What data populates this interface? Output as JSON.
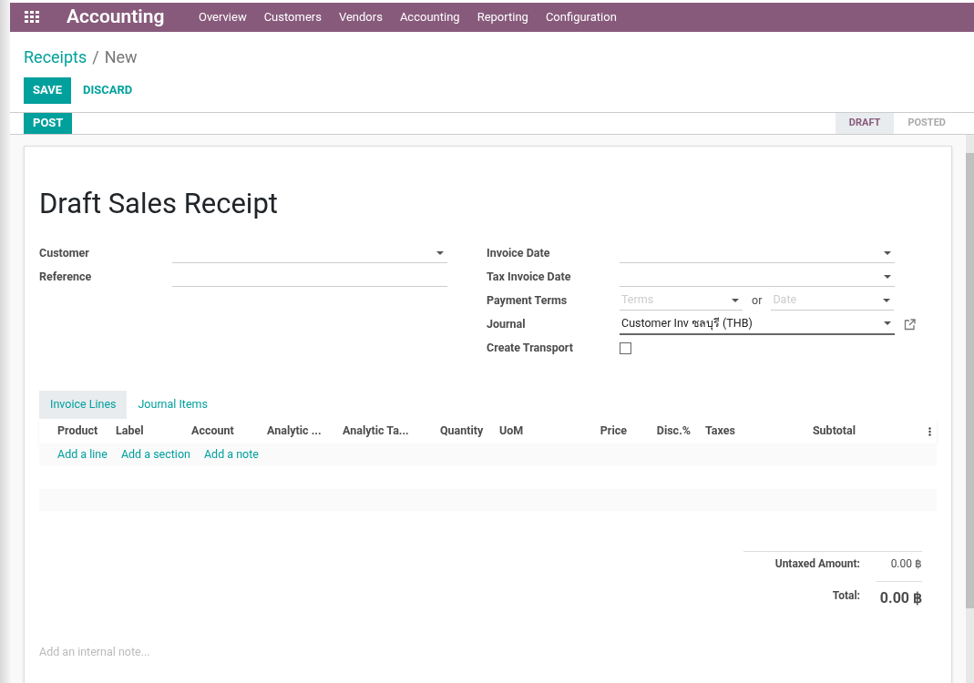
{
  "navbar": {
    "app_title": "Accounting",
    "menu": [
      "Overview",
      "Customers",
      "Vendors",
      "Accounting",
      "Reporting",
      "Configuration"
    ]
  },
  "breadcrumb": {
    "parent": "Receipts",
    "separator": "/",
    "current": "New"
  },
  "buttons": {
    "save": "SAVE",
    "discard": "DISCARD",
    "post": "POST"
  },
  "stages": [
    {
      "label": "DRAFT",
      "selected": true
    },
    {
      "label": "POSTED",
      "selected": false
    }
  ],
  "form": {
    "title": "Draft Sales Receipt",
    "left_fields": [
      {
        "label": "Customer",
        "kind": "dropdown"
      },
      {
        "label": "Reference",
        "kind": "text"
      }
    ],
    "right_fields": [
      {
        "label": "Invoice Date",
        "kind": "dropdown"
      },
      {
        "label": "Tax Invoice Date",
        "kind": "dropdown"
      },
      {
        "label": "Payment Terms",
        "kind": "terms",
        "placeholder": "Terms",
        "or": "or",
        "placeholder_2": "Date"
      },
      {
        "label": "Journal",
        "kind": "journal",
        "value": "Customer Inv ชลบุรี (THB)"
      },
      {
        "label": "Create Transport",
        "kind": "checkbox",
        "checked": false
      }
    ]
  },
  "tabs": [
    {
      "label": "Invoice Lines",
      "selected": true
    },
    {
      "label": "Journal Items",
      "selected": false
    }
  ],
  "table": {
    "columns": [
      "Product",
      "Label",
      "Account",
      "Analytic ...",
      "Analytic Ta...",
      "Quantity",
      "UoM",
      "Price",
      "Disc.%",
      "Taxes",
      "Subtotal"
    ],
    "add_links": [
      "Add a line",
      "Add a section",
      "Add a note"
    ]
  },
  "totals": {
    "untaxed_label": "Untaxed Amount:",
    "untaxed_value": "0.00 ฿",
    "total_label": "Total:",
    "total_value": "0.00 ฿"
  },
  "internal_note": {
    "placeholder": "Add an internal note..."
  }
}
